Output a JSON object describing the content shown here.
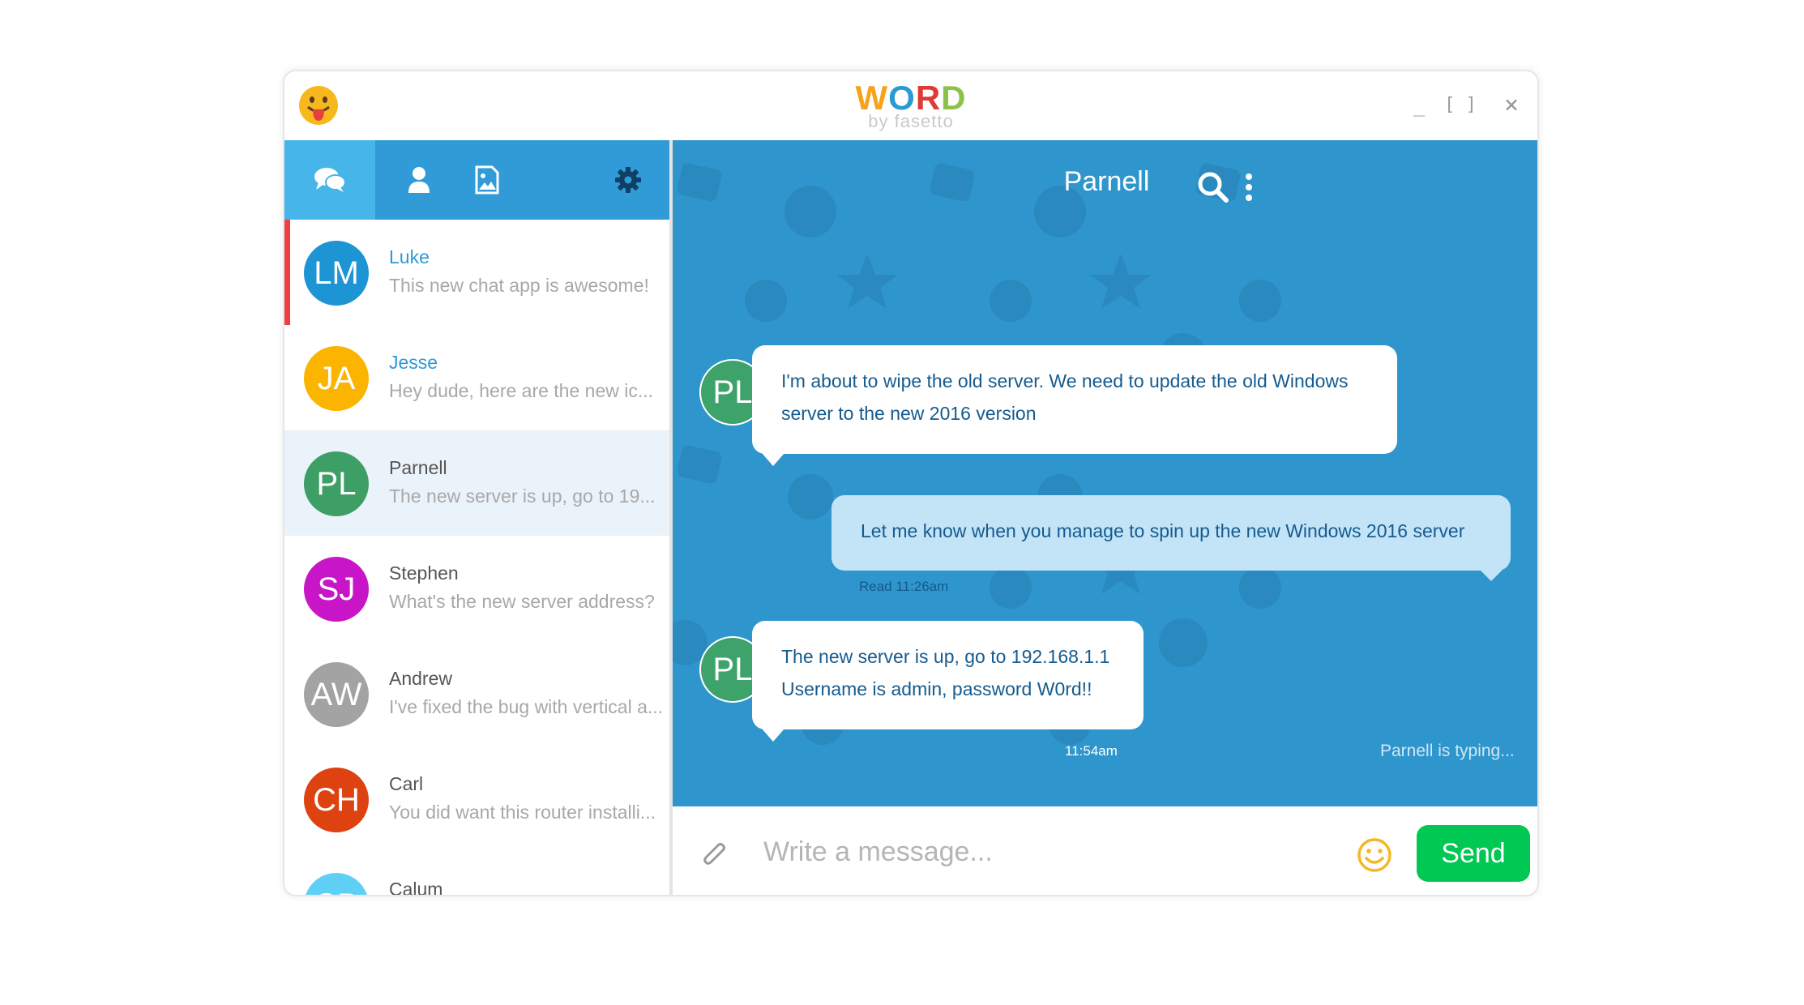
{
  "window": {
    "logo_word": [
      "W",
      "O",
      "R",
      "D"
    ],
    "logo_colors": [
      "#f7a21b",
      "#2a9ad6",
      "#de3b37",
      "#8bc34a"
    ],
    "logo_sub": "by fasetto",
    "minimize": "_",
    "maximize": "[ ]",
    "close": "×"
  },
  "sidebar": {
    "tabs": [
      {
        "name": "chat-tab",
        "icon": "chat-bubbles-icon"
      },
      {
        "name": "contacts-tab",
        "icon": "user-icon"
      },
      {
        "name": "media-tab",
        "icon": "image-icon"
      },
      {
        "name": "settings-tab",
        "icon": "gear-icon"
      }
    ],
    "contacts": [
      {
        "initials": "LM",
        "name": "Luke",
        "preview": "This new chat app is awesome!",
        "color": "#1d95d4",
        "highlight": true,
        "unread": true,
        "selected": false
      },
      {
        "initials": "JA",
        "name": "Jesse",
        "preview": "Hey dude, here are the new ic...",
        "color": "#fbb400",
        "highlight": true,
        "unread": false,
        "selected": false
      },
      {
        "initials": "PL",
        "name": "Parnell",
        "preview": "The new server is up, go to 19...",
        "color": "#3e9f66",
        "highlight": false,
        "unread": false,
        "selected": true
      },
      {
        "initials": "SJ",
        "name": "Stephen",
        "preview": "What's the new server address?",
        "color": "#c815c8",
        "highlight": false,
        "unread": false,
        "selected": false
      },
      {
        "initials": "AW",
        "name": "Andrew",
        "preview": "I've fixed the bug with vertical a...",
        "color": "#a3a3a3",
        "highlight": false,
        "unread": false,
        "selected": false
      },
      {
        "initials": "CH",
        "name": "Carl",
        "preview": "You did want this router installi...",
        "color": "#dd4210",
        "highlight": false,
        "unread": false,
        "selected": false
      },
      {
        "initials": "CB",
        "name": "Calum",
        "preview": "",
        "color": "#5fd0f5",
        "highlight": false,
        "unread": false,
        "selected": false
      }
    ]
  },
  "chat": {
    "title": "Parnell",
    "search_icon": "search-icon",
    "menu_icon": "more-vertical-icon",
    "messages": [
      {
        "from": "PL",
        "direction": "in",
        "lines": [
          "I'm about to wipe the old server. We need to update the old Windows",
          "server to the new 2016 version"
        ]
      },
      {
        "direction": "out",
        "lines": [
          "Let me know when you manage to spin up the new Windows 2016 server"
        ],
        "meta": "Read 11:26am"
      },
      {
        "from": "PL",
        "direction": "in",
        "lines": [
          "The new server is up, go to 192.168.1.1",
          "Username is admin, password W0rd!!"
        ],
        "time": "11:54am"
      }
    ],
    "typing": "Parnell is typing..."
  },
  "composer": {
    "placeholder": "Write a message...",
    "send_label": "Send",
    "attach_icon": "paperclip-icon",
    "emoji_icon": "smiley-icon"
  },
  "colors": {
    "accent": "#309bd6",
    "accent_active": "#45b5ea",
    "chat_bg": "#2f96cd",
    "send": "#00c853",
    "unread_marker": "#ee4040"
  }
}
